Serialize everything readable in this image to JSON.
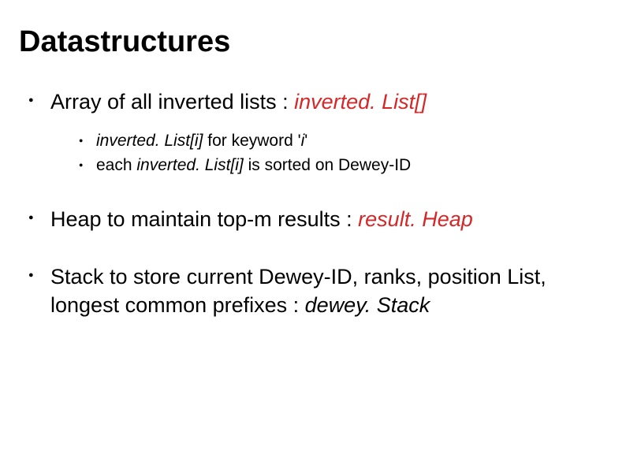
{
  "title": "Datastructures",
  "items": [
    {
      "prefix": "Array of all inverted lists : ",
      "term": "inverted. List[]",
      "sub": [
        {
          "term": "inverted. List[i]",
          "mid": " for keyword '",
          "var": "i",
          "end": "'"
        },
        {
          "pre": "each ",
          "term": "inverted. List[i]",
          "post": " is sorted on Dewey-ID"
        }
      ]
    },
    {
      "prefix": "Heap to maintain top-m results : ",
      "term": "result. Heap"
    },
    {
      "prefix": "Stack to store current Dewey-ID, ranks, position List, longest common prefixes : ",
      "term": "dewey. Stack"
    }
  ]
}
